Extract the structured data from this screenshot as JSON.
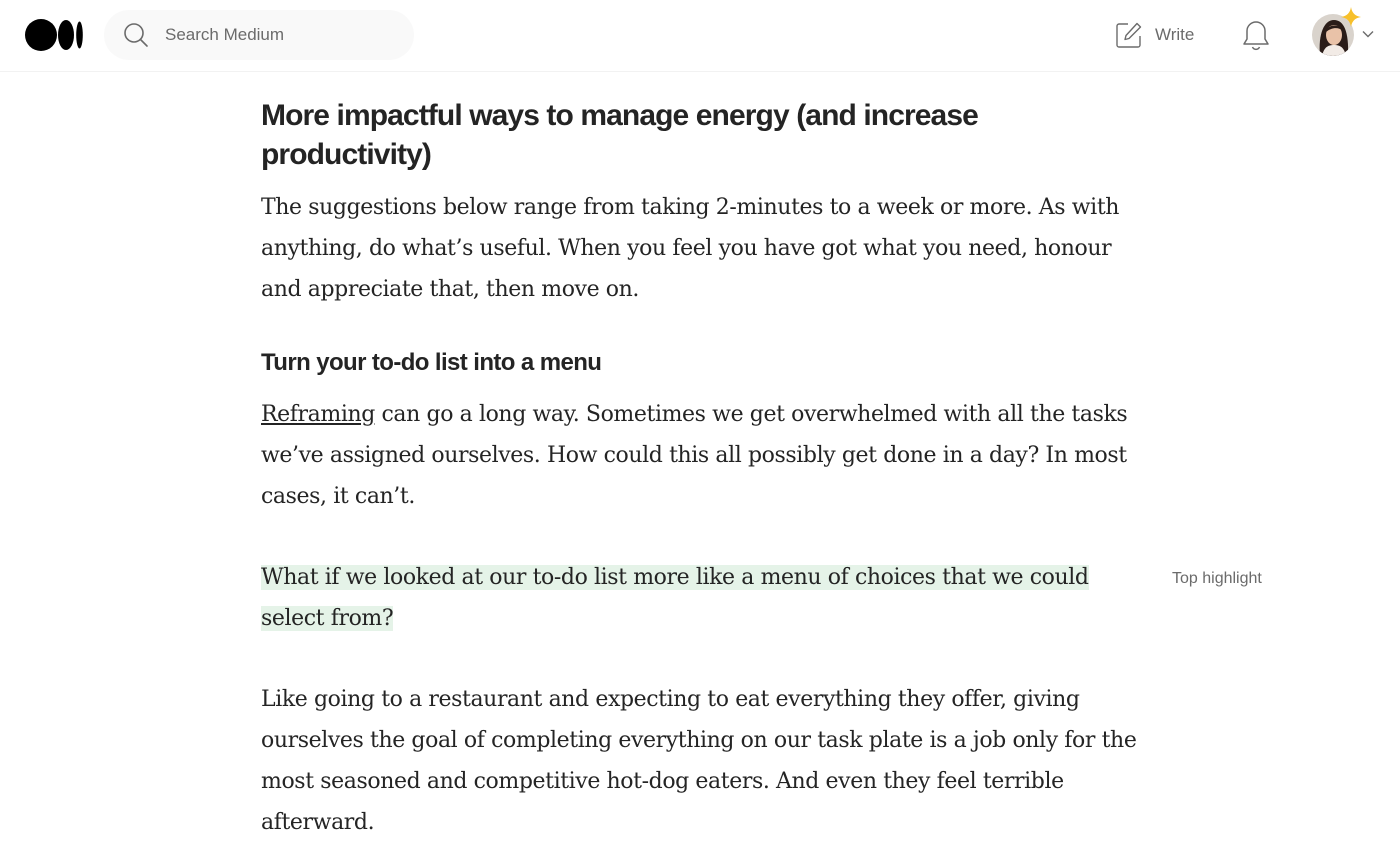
{
  "header": {
    "logo_icon": "medium-logo-icon",
    "search": {
      "placeholder": "Search Medium",
      "icon": "search-icon"
    },
    "write_label": "Write",
    "write_icon": "pencil-square-icon",
    "notifications_icon": "bell-icon",
    "avatar_icon": "user-avatar",
    "member_badge_icon": "sparkle-icon",
    "menu_icon": "chevron-down-icon",
    "accent_color": "#f7c02b"
  },
  "article": {
    "section_heading": "More impactful ways to manage energy (and increase productivity)",
    "intro_paragraph": "The suggestions below range from taking 2-minutes to a week or more. As with anything, do what’s useful. When you feel you have got what you need, honour and appreciate that, then move on.",
    "subheading": "Turn your to-do list into a menu",
    "paragraph2_link": "Reframing",
    "paragraph2_rest": " can go a long way. Sometimes we get overwhelmed with all the tasks we’ve assigned ourselves. How could this all possibly get done in a day? In most cases, it can’t.",
    "highlight_text": "What if we looked at our to-do list more like a menu of choices that we could select from?",
    "highlight_label": "Top highlight",
    "highlight_color": "#e5f3e8",
    "paragraph3": "Like going to a restaurant and expecting to eat everything they offer, giving ourselves the goal of completing everything on our task plate is a job only for the most seasoned and competitive hot-dog eaters. And even they feel terrible afterward."
  }
}
